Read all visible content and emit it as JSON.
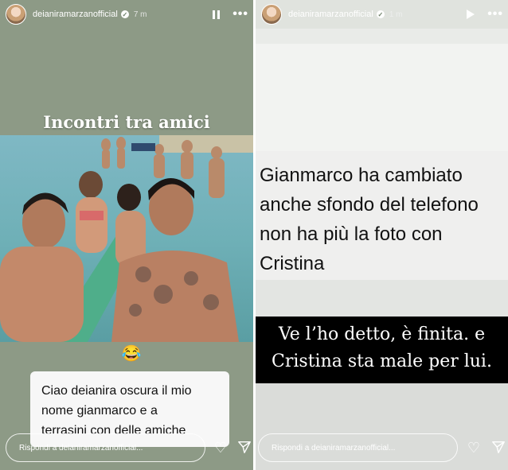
{
  "left_story": {
    "username": "deianiramarzanofficial",
    "timestamp": "7 m",
    "caption": "Incontri tra amici",
    "emoji": "😂",
    "chat_message": [
      "Ciao deianira oscura il mio",
      "nome gianmarco e a",
      "terrasini con delle amiche"
    ],
    "reply_placeholder": "Rispondi a deianiramarzanofficial..."
  },
  "right_story": {
    "username": "deianiramarzanofficial",
    "timestamp": "1 m",
    "chat_message": [
      "Gianmarco ha cambiato",
      "anche sfondo del telefono",
      "non ha più la foto con",
      "Cristina"
    ],
    "quote": [
      "Ve l’ho detto, è finita. e",
      "Cristina sta male per lui."
    ],
    "reply_placeholder": "Rispondi a deianiramarzanofficial..."
  },
  "icons": {
    "verified": "verified-badge-icon",
    "pause": "pause-icon",
    "play": "play-icon",
    "more": "more-icon",
    "like": "heart-icon",
    "share": "send-icon"
  }
}
